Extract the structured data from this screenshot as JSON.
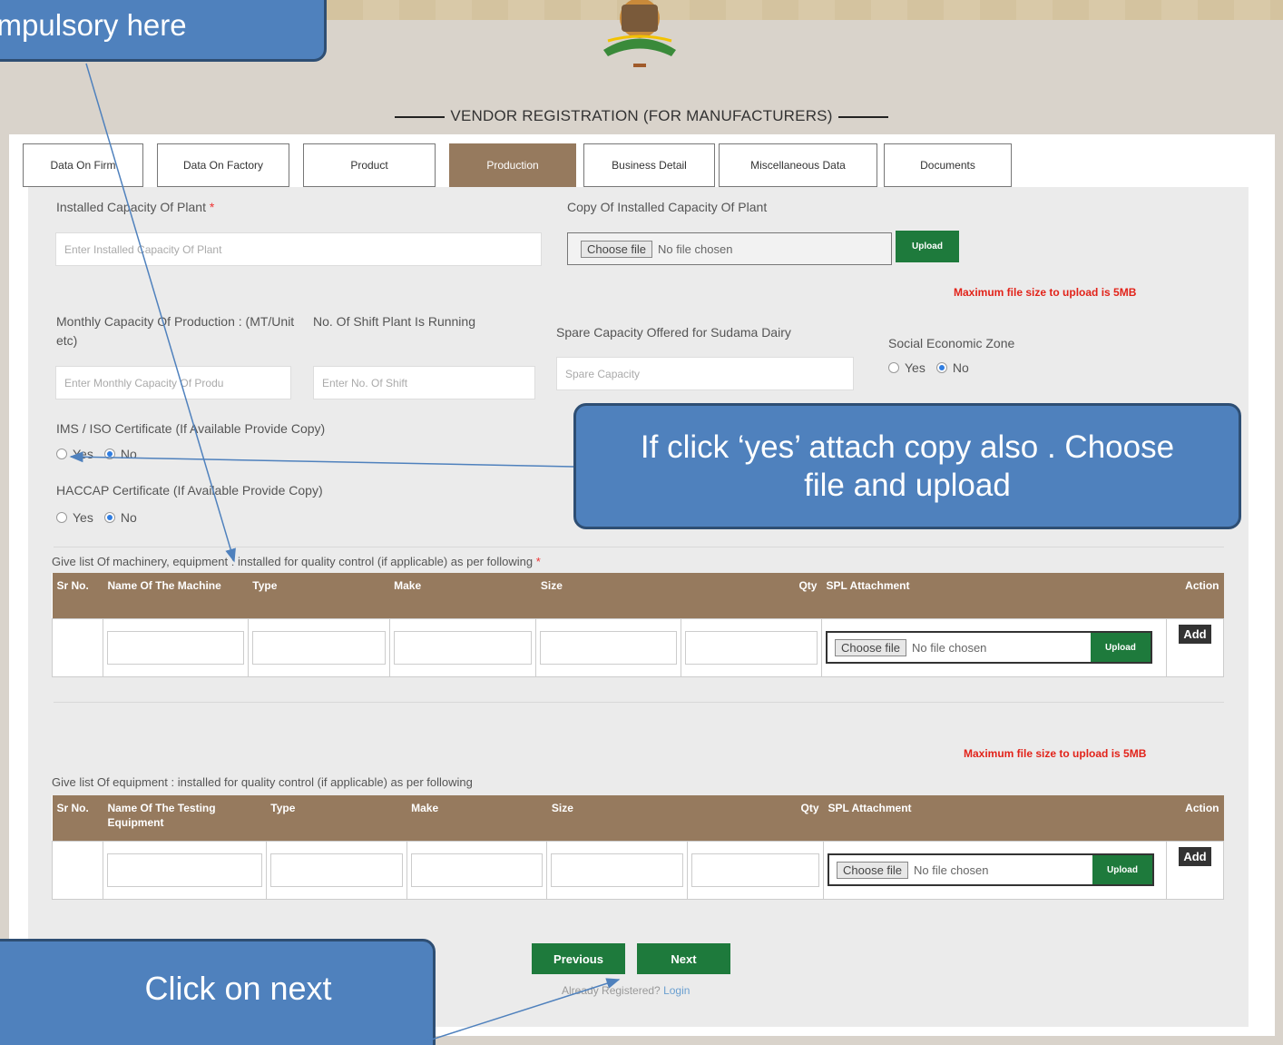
{
  "header": {
    "title": "VENDOR REGISTRATION (FOR MANUFACTURERS)"
  },
  "tabs": [
    {
      "label": "Data On Firm"
    },
    {
      "label": "Data On Factory"
    },
    {
      "label": "Product"
    },
    {
      "label": "Production",
      "active": true
    },
    {
      "label": "Business Detail"
    },
    {
      "label": "Miscellaneous Data"
    },
    {
      "label": "Documents"
    }
  ],
  "form": {
    "installed_capacity": {
      "label": "Installed Capacity Of Plant",
      "required_mark": "*",
      "placeholder": "Enter Installed Capacity Of Plant"
    },
    "capacity_copy": {
      "label": "Copy Of Installed Capacity Of Plant",
      "choose_label": "Choose file",
      "file_status": "No file chosen",
      "upload_label": "Upload"
    },
    "max_file_note": "Maximum file size to upload is 5MB",
    "monthly_capacity": {
      "label": "Monthly Capacity Of Production : (MT/Unit etc)",
      "placeholder": "Enter Monthly Capacity Of Produ"
    },
    "shift_count": {
      "label": "No. Of Shift Plant Is Running",
      "placeholder": "Enter No. Of Shift"
    },
    "spare_capacity": {
      "label": "Spare Capacity Offered for Sudama Dairy",
      "placeholder": "Spare Capacity"
    },
    "sez": {
      "label": "Social Economic Zone",
      "yes": "Yes",
      "no": "No",
      "selected": "No"
    },
    "ims_iso": {
      "label": "IMS / ISO Certificate (If Available Provide Copy)",
      "yes": "Yes",
      "no": "No",
      "selected": "No"
    },
    "haccap": {
      "label": "HACCAP Certificate (If Available Provide Copy)",
      "yes": "Yes",
      "no": "No",
      "selected": "No"
    }
  },
  "machinery_table": {
    "caption": "Give list Of machinery, equipment : installed for quality control (if applicable) as per following",
    "required_mark": "*",
    "columns": [
      "Sr No.",
      "Name Of The Machine",
      "Type",
      "Make",
      "Size",
      "Qty",
      "SPL Attachment",
      "Action"
    ],
    "row": {
      "choose_label": "Choose file",
      "file_status": "No file chosen",
      "upload_label": "Upload",
      "add_label": "Add"
    }
  },
  "equipment_table": {
    "max_file_note": "Maximum file size to upload is 5MB",
    "caption": "Give list Of equipment : installed for quality control (if applicable) as per following",
    "columns": [
      "Sr No.",
      "Name Of The Testing Equipment",
      "Type",
      "Make",
      "Size",
      "Qty",
      "SPL Attachment",
      "Action"
    ],
    "row": {
      "choose_label": "Choose file",
      "file_status": "No file chosen",
      "upload_label": "Upload",
      "add_label": "Add"
    }
  },
  "footer": {
    "previous_label": "Previous",
    "next_label": "Next",
    "already_text": "Already Registered?",
    "login_label": "Login"
  },
  "callouts": {
    "compulsory": "Compulsory here",
    "attach_copy": "If click ‘yes’ attach copy also . Choose file and upload",
    "click_next": "Click on next"
  },
  "colors": {
    "brown_header": "#967a5e",
    "green_button": "#1e7a3c",
    "callout_blue": "#4f81bd",
    "error_red": "#e2231a"
  }
}
